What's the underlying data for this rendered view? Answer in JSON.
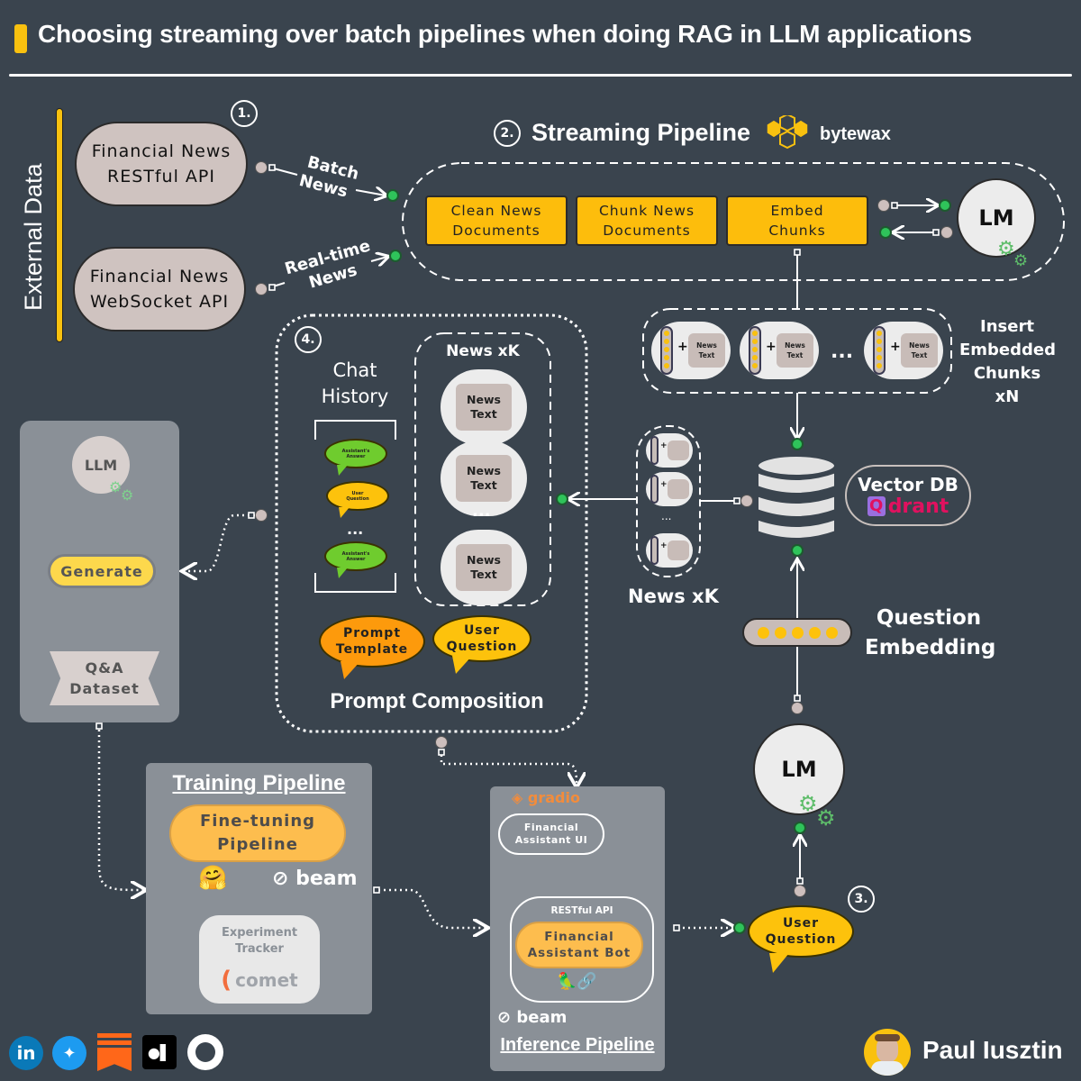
{
  "title": "Choosing streaming over batch pipelines when doing RAG in LLM applications",
  "colors": {
    "background": "#3a444e",
    "accent": "#f9c10f",
    "step": "#fdbd0c",
    "connector_green": "#2fc35a",
    "connector_gray": "#cdbfbd",
    "panel": "#8a9097"
  },
  "external_data": {
    "label": "External Data",
    "badge": "1.",
    "sources": [
      {
        "line1": "Financial News",
        "line2": "RESTful API"
      },
      {
        "line1": "Financial News",
        "line2": "WebSocket API"
      }
    ],
    "edges": [
      {
        "line1": "Batch",
        "line2": "News"
      },
      {
        "line1": "Real-time",
        "line2": "News"
      }
    ]
  },
  "streaming": {
    "badge": "2.",
    "title": "Streaming Pipeline",
    "brand": "bytewax",
    "steps": [
      {
        "line1": "Clean News",
        "line2": "Documents"
      },
      {
        "line1": "Chunk News",
        "line2": "Documents"
      },
      {
        "line1": "Embed",
        "line2": "Chunks"
      }
    ],
    "lm_label": "LM",
    "chunk_text_line1": "News",
    "chunk_text_line2": "Text",
    "ellipsis": "...",
    "insert_label": [
      "Insert",
      "Embedded",
      "Chunks",
      "xN"
    ]
  },
  "vector_db": {
    "label": "Vector DB",
    "brand": "drant",
    "brand_icon": "Q",
    "retrieved_label": "News xK"
  },
  "question": {
    "embedding_label": [
      "Question",
      "Embedding"
    ],
    "lm_label": "LM",
    "badge": "3.",
    "user_q_line1": "User",
    "user_q_line2": "Question"
  },
  "prompt_composition": {
    "badge": "4.",
    "chat_history_line1": "Chat",
    "chat_history_line2": "History",
    "chat_items": [
      {
        "line1": "Assistant's",
        "line2": "Answer",
        "color": "#6fcc2e"
      },
      {
        "line1": "User",
        "line2": "Question",
        "color": "#fdbd0c"
      },
      {
        "line1": "Assistant's",
        "line2": "Answer",
        "color": "#6fcc2e"
      }
    ],
    "ellipsis": "...",
    "news_title": "News xK",
    "news_item_line1": "News",
    "news_item_line2": "Text",
    "prompt_template_line1": "Prompt",
    "prompt_template_line2": "Template",
    "user_question_line1": "User",
    "user_question_line2": "Question",
    "title": "Prompt Composition"
  },
  "qa_generation": {
    "llm_label": "LLM",
    "generate_label": "Generate",
    "dataset_line1": "Q&A",
    "dataset_line2": "Dataset"
  },
  "training": {
    "title": "Training Pipeline",
    "finetune_line1": "Fine-tuning",
    "finetune_line2": "Pipeline",
    "hf_icon": "🤗",
    "beam": "beam",
    "tracker_line1": "Experiment",
    "tracker_line2": "Tracker",
    "comet": "comet"
  },
  "inference": {
    "gradio": "gradio",
    "ui_line1": "Financial",
    "ui_line2": "Assistant UI",
    "api_label": "RESTful API",
    "bot_line1": "Financial",
    "bot_line2": "Assistant Bot",
    "langchain_icons": "🦜🔗",
    "beam": "beam",
    "title": "Inference Pipeline"
  },
  "footer": {
    "socials": [
      {
        "name": "linkedin",
        "glyph": "in",
        "color": "#0a79b8"
      },
      {
        "name": "twitter",
        "glyph": "🐦",
        "color": "#1d9bf0"
      },
      {
        "name": "substack",
        "glyph": "",
        "color": "#ff6719"
      },
      {
        "name": "medium",
        "glyph": "●▌",
        "color": "#000000"
      },
      {
        "name": "github",
        "glyph": "",
        "color": "#ffffff"
      }
    ],
    "author": "Paul Iusztin"
  }
}
